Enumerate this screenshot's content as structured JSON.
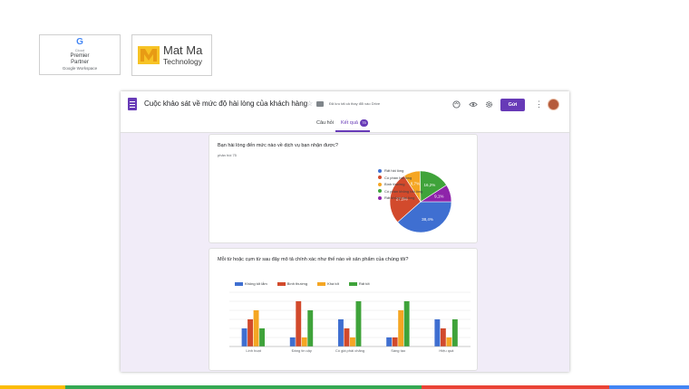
{
  "badges": {
    "google": {
      "brand_g": "G",
      "line1": "Cloud",
      "line2": "Premier",
      "line3": "Partner",
      "line4": "Google Workspace"
    },
    "matma": {
      "line1": "Mat Ma",
      "line2": "Technology"
    }
  },
  "form": {
    "title": "Cuộc khảo sát về mức độ hài lòng của khách hàng",
    "save_note": "Đã lưu tất cả thay đổi vào Drive",
    "send_label": "Gửi",
    "tabs": [
      {
        "label": "Câu hỏi"
      },
      {
        "label": "Kết quả",
        "badge": "75"
      }
    ],
    "icons": {
      "palette": "palette-icon",
      "preview": "eye-icon",
      "settings": "gear-icon",
      "more": "more-vert-icon",
      "star": "star-icon",
      "folder": "folder-icon"
    }
  },
  "question1": {
    "title": "Bạn hài lòng đến mức nào về dịch vụ bạn nhận được?",
    "responses": "phản hồi 75"
  },
  "question2": {
    "title": "Mỗi từ hoặc cụm từ sau đây mô tả chính xác như thế nào về sản phẩm của chúng tôi?"
  },
  "colors": {
    "blue": "#3f6fd1",
    "red": "#d24a2c",
    "orange": "#f5a623",
    "green": "#3fa33a",
    "purple": "#8e24aa",
    "accent": "#673ab7"
  },
  "chart_data": [
    {
      "type": "pie",
      "slices": [
        {
          "label": "Rất hài lòng",
          "value": 38.4,
          "color": "#3f6fd1",
          "show_label": true
        },
        {
          "label": "Có phần hài lòng",
          "value": 27.5,
          "color": "#d24a2c",
          "show_label": true
        },
        {
          "label": "Bình thường",
          "value": 8.7,
          "color": "#f5a623",
          "show_label": true
        },
        {
          "label": "Có phần không hài lòng",
          "value": 16.2,
          "color": "#3fa33a",
          "show_label": true
        },
        {
          "label": "Rất không hài lòng",
          "value": 9.1,
          "color": "#8e24aa",
          "show_label": true
        }
      ],
      "legend_position": "right"
    },
    {
      "type": "bar",
      "categories": [
        "Linh hoạt",
        "Đáng tin cậy",
        "Có giá phải chăng",
        "Sáng tạo",
        "Hiệu quả"
      ],
      "series": [
        {
          "name": "Không tốt lắm",
          "color": "#3f6fd1",
          "values": [
            8,
            4,
            12,
            4,
            12
          ]
        },
        {
          "name": "Bình thường",
          "color": "#d24a2c",
          "values": [
            12,
            20,
            8,
            4,
            8
          ]
        },
        {
          "name": "Khá tốt",
          "color": "#f5a623",
          "values": [
            16,
            4,
            4,
            16,
            4
          ]
        },
        {
          "name": "Rất tốt",
          "color": "#3fa33a",
          "values": [
            8,
            16,
            20,
            20,
            12
          ]
        }
      ],
      "ylim": [
        0,
        24
      ],
      "grid": true,
      "legend_position": "top"
    }
  ],
  "footer_colors": [
    "#fbbc04",
    "#34a853",
    "#ea4335",
    "#4285f4"
  ]
}
